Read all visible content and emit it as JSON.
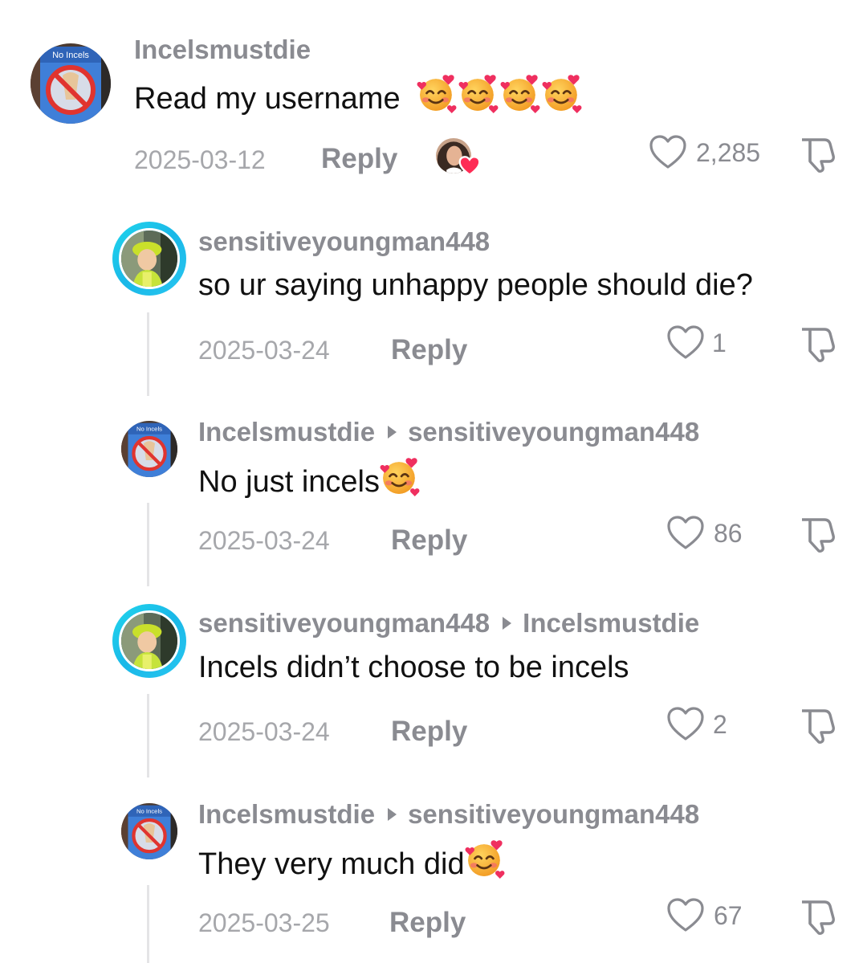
{
  "comments": [
    {
      "username": "Incelsmustdie",
      "reply_to": "",
      "text": "Read my username",
      "emoji": [
        "smiling-face-with-hearts",
        "smiling-face-with-hearts",
        "smiling-face-with-hearts",
        "smiling-face-with-hearts"
      ],
      "date": "2025-03-12",
      "reply_label": "Reply",
      "likes": "2,285",
      "avatar_badge": "No Incels",
      "liked_by_creator": true
    },
    {
      "username": "sensitiveyoungman448",
      "reply_to": "",
      "text": "so ur saying unhappy people should die?",
      "date": "2025-03-24",
      "reply_label": "Reply",
      "likes": "1"
    },
    {
      "username": "Incelsmustdie",
      "reply_to": "sensitiveyoungman448",
      "text": "No just incels",
      "emoji": [
        "smiling-face-with-hearts"
      ],
      "date": "2025-03-24",
      "reply_label": "Reply",
      "likes": "86",
      "avatar_badge": "No Incels"
    },
    {
      "username": "sensitiveyoungman448",
      "reply_to": "Incelsmustdie",
      "text": "Incels didn’t choose to be incels",
      "date": "2025-03-24",
      "reply_label": "Reply",
      "likes": "2"
    },
    {
      "username": "Incelsmustdie",
      "reply_to": "sensitiveyoungman448",
      "text": "They very much did",
      "emoji": [
        "smiling-face-with-hearts"
      ],
      "date": "2025-03-25",
      "reply_label": "Reply",
      "likes": "67",
      "avatar_badge": "No Incels"
    }
  ],
  "colors": {
    "username": "#8a8b91",
    "text": "#111111",
    "date": "#a6a7ab",
    "story_ring": "#20d5ec",
    "heart_badge": "#fe2c55"
  }
}
